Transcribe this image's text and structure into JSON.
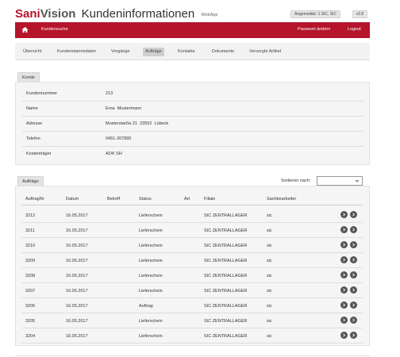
{
  "header": {
    "brand_sani": "Sani",
    "brand_vision": "Vision",
    "title": "Kundeninformationen",
    "subtitle": "WebApp",
    "logged_in": "Angemeldet: 1 SIC, SIC",
    "version": "v2.8"
  },
  "topnav": {
    "home_icon": "home-icon",
    "kundensuche": "Kundensuche",
    "passwort": "Passwort ändern",
    "logout": "Logout"
  },
  "tabs": [
    {
      "label": "Übersicht",
      "active": false
    },
    {
      "label": "Kundenstammdaten",
      "active": false
    },
    {
      "label": "Vorgänge",
      "active": false
    },
    {
      "label": "Aufträge",
      "active": true
    },
    {
      "label": "Kontakte",
      "active": false
    },
    {
      "label": "Dokumente",
      "active": false
    },
    {
      "label": "Versorgte Artikel",
      "active": false
    }
  ],
  "kunde": {
    "section_label": "Kunde",
    "rows": [
      {
        "label": "Kundennummer",
        "value": "213"
      },
      {
        "label": "Name",
        "value": "Erna  Mustermann"
      },
      {
        "label": "Adresse",
        "value": "Musterstarße 21  23552  Lübeck"
      },
      {
        "label": "Telefon",
        "value": "0451-207895"
      },
      {
        "label": "Kostenträger",
        "value": "AOK SH"
      }
    ]
  },
  "auftraege": {
    "section_label": "Aufträge",
    "sort_label": "Sortieren nach:",
    "sort_value": "",
    "columns": [
      "AuftragNr",
      "Datum",
      "Betreff",
      "Status",
      "Art",
      "Filiale",
      "Sachbearbeiter"
    ],
    "rows": [
      {
        "nr": "3212",
        "datum": "16.05.2017",
        "betreff": "",
        "status": "Lieferschein",
        "art": "",
        "filiale": "SIC ZENTRALLAGER",
        "sb": "sic"
      },
      {
        "nr": "3211",
        "datum": "16.05.2017",
        "betreff": "",
        "status": "Lieferschein",
        "art": "",
        "filiale": "SIC ZENTRALLAGER",
        "sb": "sic"
      },
      {
        "nr": "3210",
        "datum": "16.05.2017",
        "betreff": "",
        "status": "Lieferschein",
        "art": "",
        "filiale": "SIC ZENTRALLAGER",
        "sb": "sic"
      },
      {
        "nr": "3209",
        "datum": "16.05.2017",
        "betreff": "",
        "status": "Lieferschein",
        "art": "",
        "filiale": "SIC ZENTRALLAGER",
        "sb": "sic"
      },
      {
        "nr": "3208",
        "datum": "16.05.2017",
        "betreff": "",
        "status": "Lieferschein",
        "art": "",
        "filiale": "SIC ZENTRALLAGER",
        "sb": "sic"
      },
      {
        "nr": "3207",
        "datum": "16.05.2017",
        "betreff": "",
        "status": "Lieferschein",
        "art": "",
        "filiale": "SIC ZENTRALLAGER",
        "sb": "sic"
      },
      {
        "nr": "3206",
        "datum": "16.05.2017",
        "betreff": "",
        "status": "Auftrag",
        "art": "",
        "filiale": "SIC ZENTRALLAGER",
        "sb": "sic"
      },
      {
        "nr": "3205",
        "datum": "16.05.2017",
        "betreff": "",
        "status": "Lieferschein",
        "art": "",
        "filiale": "SIC ZENTRALLAGER",
        "sb": "sic"
      },
      {
        "nr": "3204",
        "datum": "16.05.2017",
        "betreff": "",
        "status": "Lieferschein",
        "art": "",
        "filiale": "SIC ZENTRALLAGER",
        "sb": "sic"
      }
    ]
  },
  "colors": {
    "brand_red": "#b5142b",
    "tab_active": "#cfcfcf"
  }
}
